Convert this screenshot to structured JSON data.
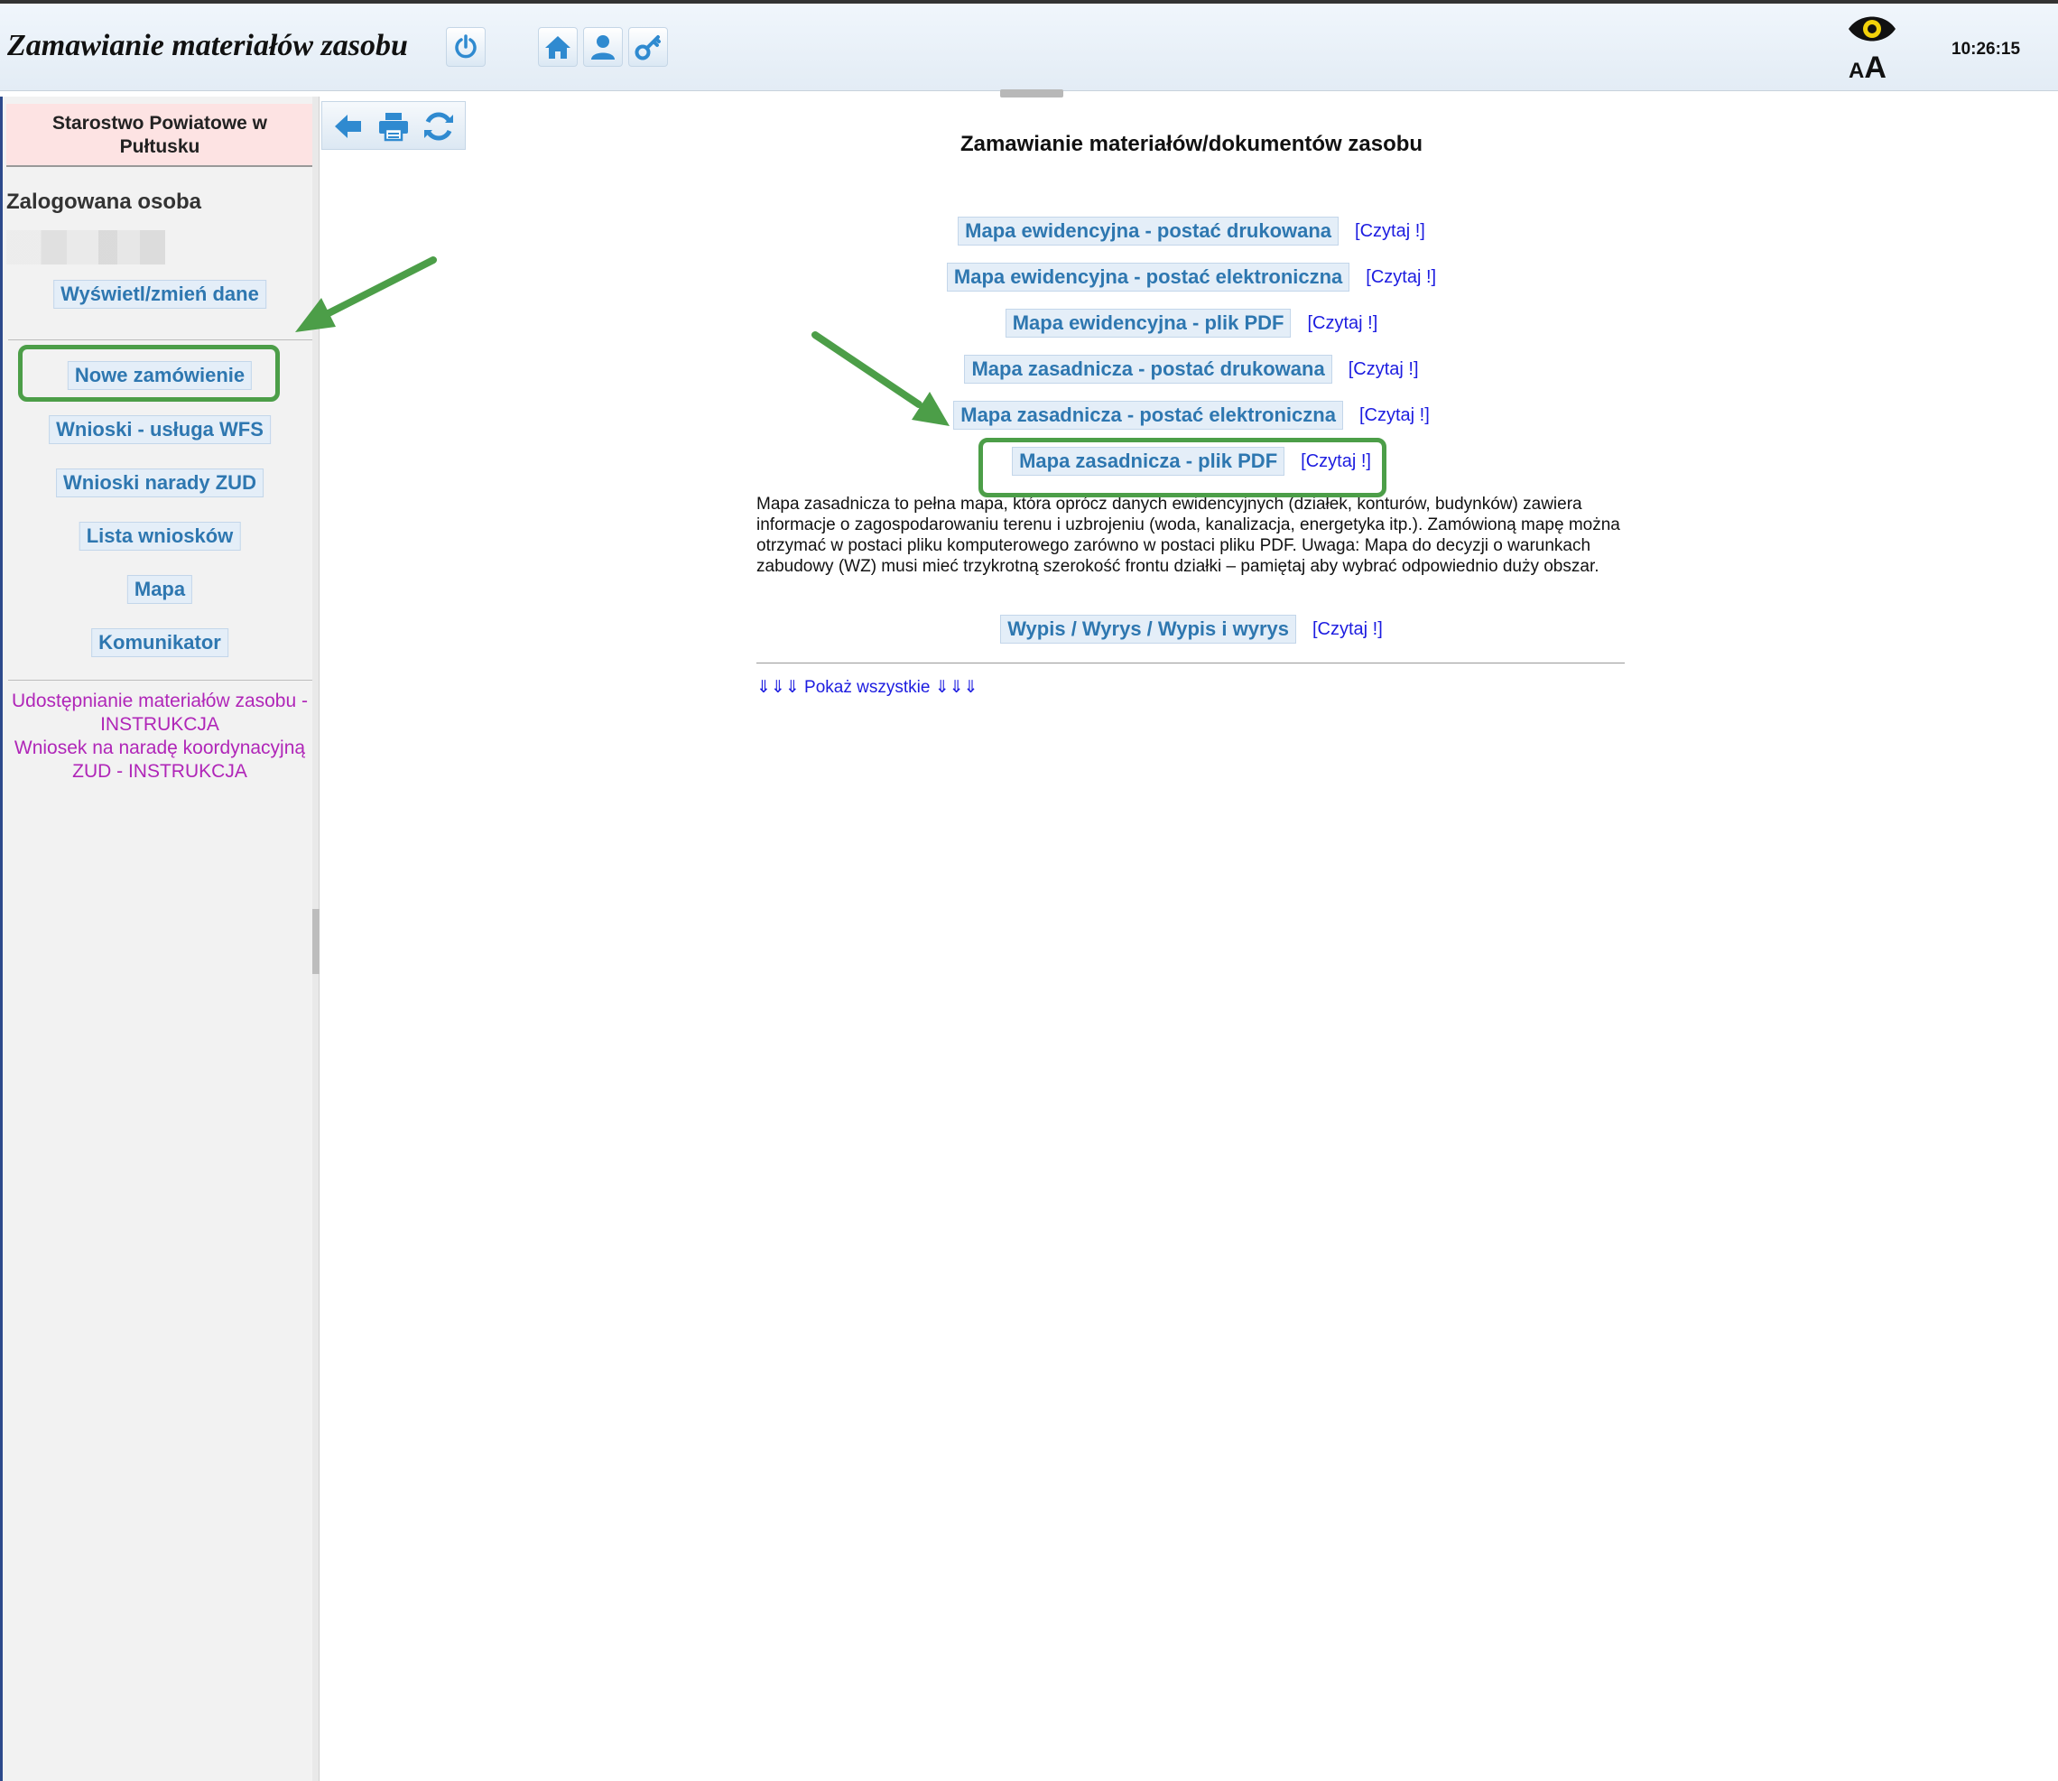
{
  "header": {
    "title": "Zamawianie materiałów zasobu",
    "clock": "10:26:15",
    "font_small": "A",
    "font_big": "A",
    "icons": [
      "power-icon",
      "home-icon",
      "user-icon",
      "key-icon",
      "eye-icon"
    ]
  },
  "sidebar": {
    "org_name": "Starostwo Powiatowe w Pułtusku",
    "user_label": "Zalogowana osoba",
    "edit_data": "Wyświetl/zmień dane",
    "menu": [
      "Nowe zamówienie",
      "Wnioski - usługa WFS",
      "Wnioski narady ZUD",
      "Lista wniosków",
      "Mapa",
      "Komunikator"
    ],
    "links": [
      "Udostępnianie materiałów zasobu - INSTRUKCJA",
      "Wniosek na naradę koordynacyjną ZUD - INSTRUKCJA"
    ]
  },
  "toolbar": {
    "icons": [
      "back-arrow-icon",
      "print-icon",
      "refresh-icon"
    ]
  },
  "main": {
    "title": "Zamawianie materiałów/dokumentów zasobu",
    "read_label": "[Czytaj !]",
    "items": [
      "Mapa ewidencyjna - postać drukowana",
      "Mapa ewidencyjna - postać elektroniczna",
      "Mapa ewidencyjna - plik PDF",
      "Mapa zasadnicza - postać drukowana",
      "Mapa zasadnicza - postać elektroniczna",
      "Mapa zasadnicza - plik PDF"
    ],
    "description": "Mapa zasadnicza to pełna mapa, która oprócz danych ewidencyjnych (działek, konturów, budynków) zawiera informacje o zagospodarowaniu terenu i uzbrojeniu (woda, kanalizacja, energetyka itp.). Zamówioną mapę można otrzymać w postaci pliku komputerowego zarówno w postaci pliku PDF. Uwaga: Mapa do decyzji o warunkach zabudowy (WZ) musi mieć trzykrotną szerokość frontu działki – pamiętaj aby wybrać odpowiednio duży obszar.",
    "extract_item": "Wypis / Wyrys / Wypis i wyrys",
    "show_all": "⇓⇓⇓ Pokaż wszystkie ⇓⇓⇓"
  },
  "colors": {
    "accent": "#2e77b0",
    "link": "#1c1ce0",
    "instruction_link": "#b026b8",
    "highlight": "#4c9e48"
  }
}
